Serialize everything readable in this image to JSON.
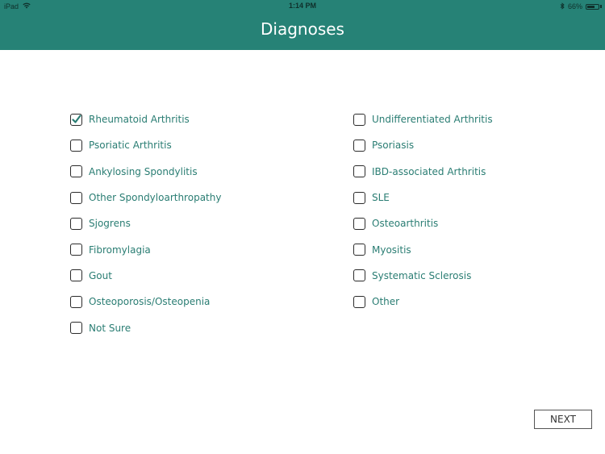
{
  "status_bar": {
    "device": "iPad",
    "time": "1:14 PM",
    "battery_percent": "66%",
    "battery_level": 0.66
  },
  "header": {
    "title": "Diagnoses"
  },
  "colors": {
    "header": "#268276",
    "label": "#2a7d73"
  },
  "diagnoses_left": [
    {
      "label": "Rheumatoid Arthritis",
      "checked": true
    },
    {
      "label": "Psoriatic Arthritis",
      "checked": false
    },
    {
      "label": "Ankylosing Spondylitis",
      "checked": false
    },
    {
      "label": "Other Spondyloarthropathy",
      "checked": false
    },
    {
      "label": "Sjogrens",
      "checked": false
    },
    {
      "label": "Fibromylagia",
      "checked": false
    },
    {
      "label": "Gout",
      "checked": false
    },
    {
      "label": "Osteoporosis/Osteopenia",
      "checked": false
    },
    {
      "label": "Not Sure",
      "checked": false
    }
  ],
  "diagnoses_right": [
    {
      "label": "Undifferentiated Arthritis",
      "checked": false
    },
    {
      "label": "Psoriasis",
      "checked": false
    },
    {
      "label": "IBD-associated Arthritis",
      "checked": false
    },
    {
      "label": "SLE",
      "checked": false
    },
    {
      "label": "Osteoarthritis",
      "checked": false
    },
    {
      "label": "Myositis",
      "checked": false
    },
    {
      "label": "Systematic Sclerosis",
      "checked": false
    },
    {
      "label": "Other",
      "checked": false
    }
  ],
  "next_label": "NEXT"
}
